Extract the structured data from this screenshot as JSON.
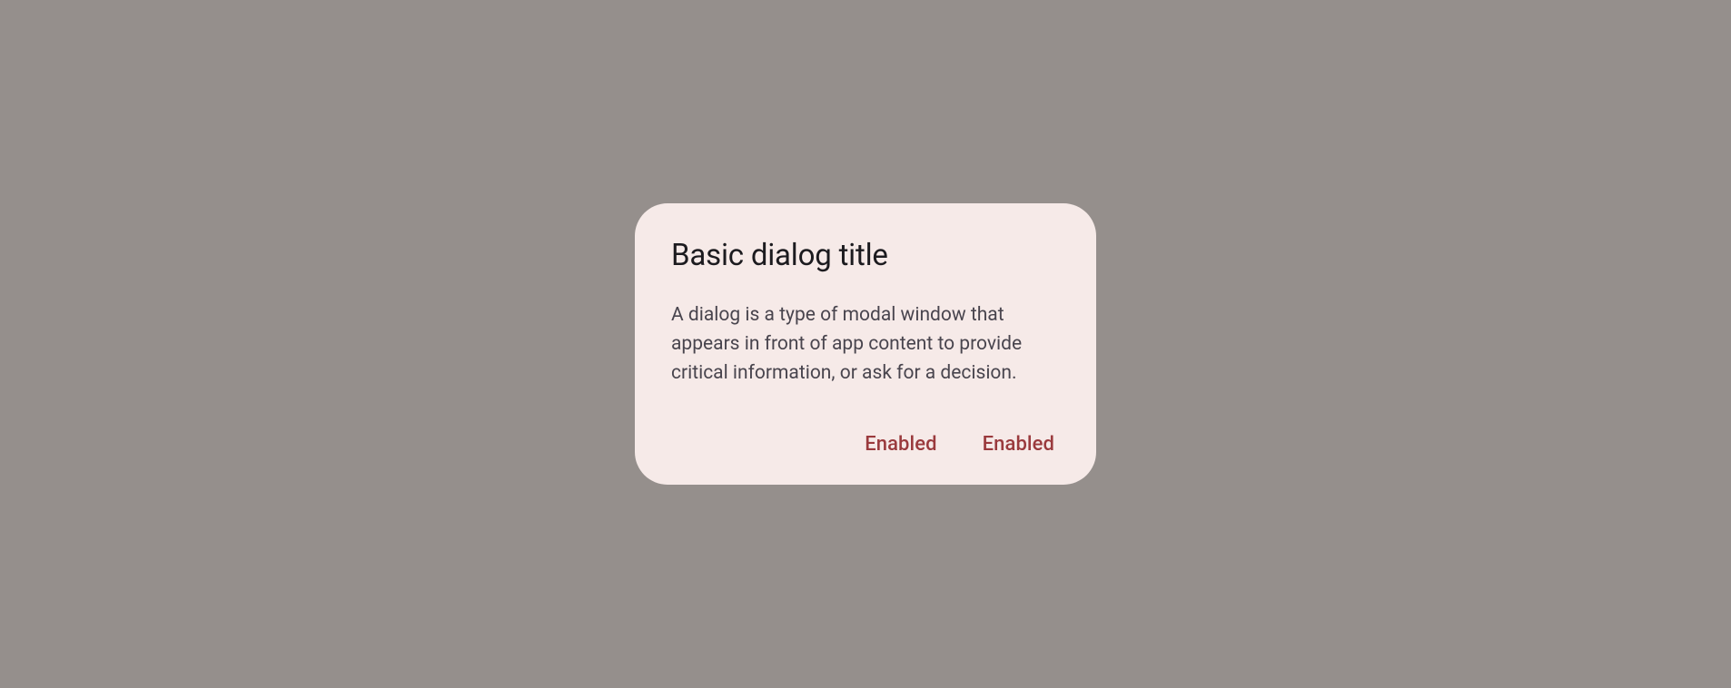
{
  "dialog": {
    "title": "Basic dialog title",
    "body": "A dialog is a type of modal window that appears in front of app content to provide critical information, or ask for a decision.",
    "actions": {
      "secondary": "Enabled",
      "primary": "Enabled"
    }
  },
  "colors": {
    "scrim": "#958f8c",
    "surface": "#f6eae8",
    "onSurface": "#1c1b1f",
    "bodyText": "#49454e",
    "actionText": "#9a3a3d"
  }
}
